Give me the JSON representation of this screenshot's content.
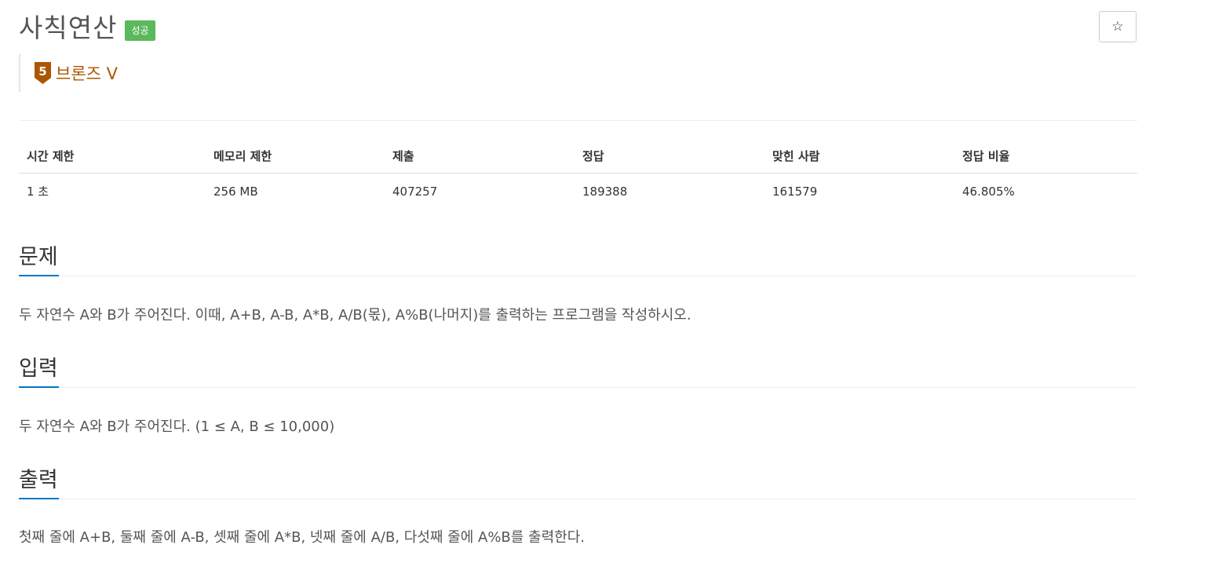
{
  "problem": {
    "title": "사칙연산",
    "result_badge": "성공",
    "tier_label": "브론즈 V",
    "tier_number": "5",
    "tier_color": "#ad5600",
    "badge_color": "#5cb85c",
    "star_icon": "☆"
  },
  "stats": {
    "headers": [
      "시간 제한",
      "메모리 제한",
      "제출",
      "정답",
      "맞힌 사람",
      "정답 비율"
    ],
    "values": [
      "1 초",
      "256 MB",
      "407257",
      "189388",
      "161579",
      "46.805%"
    ]
  },
  "sections": {
    "description": {
      "title": "문제",
      "text": "두 자연수 A와 B가 주어진다. 이때, A+B, A-B, A*B, A/B(몫), A%B(나머지)를 출력하는 프로그램을 작성하시오."
    },
    "input": {
      "title": "입력",
      "text": "두 자연수 A와 B가 주어진다. (1 ≤ A, B ≤ 10,000)"
    },
    "output": {
      "title": "출력",
      "text": "첫째 줄에 A+B, 둘째 줄에 A-B, 셋째 줄에 A*B, 넷째 줄에 A/B, 다섯째 줄에 A%B를 출력한다."
    }
  },
  "accent_color": "#0076c0"
}
